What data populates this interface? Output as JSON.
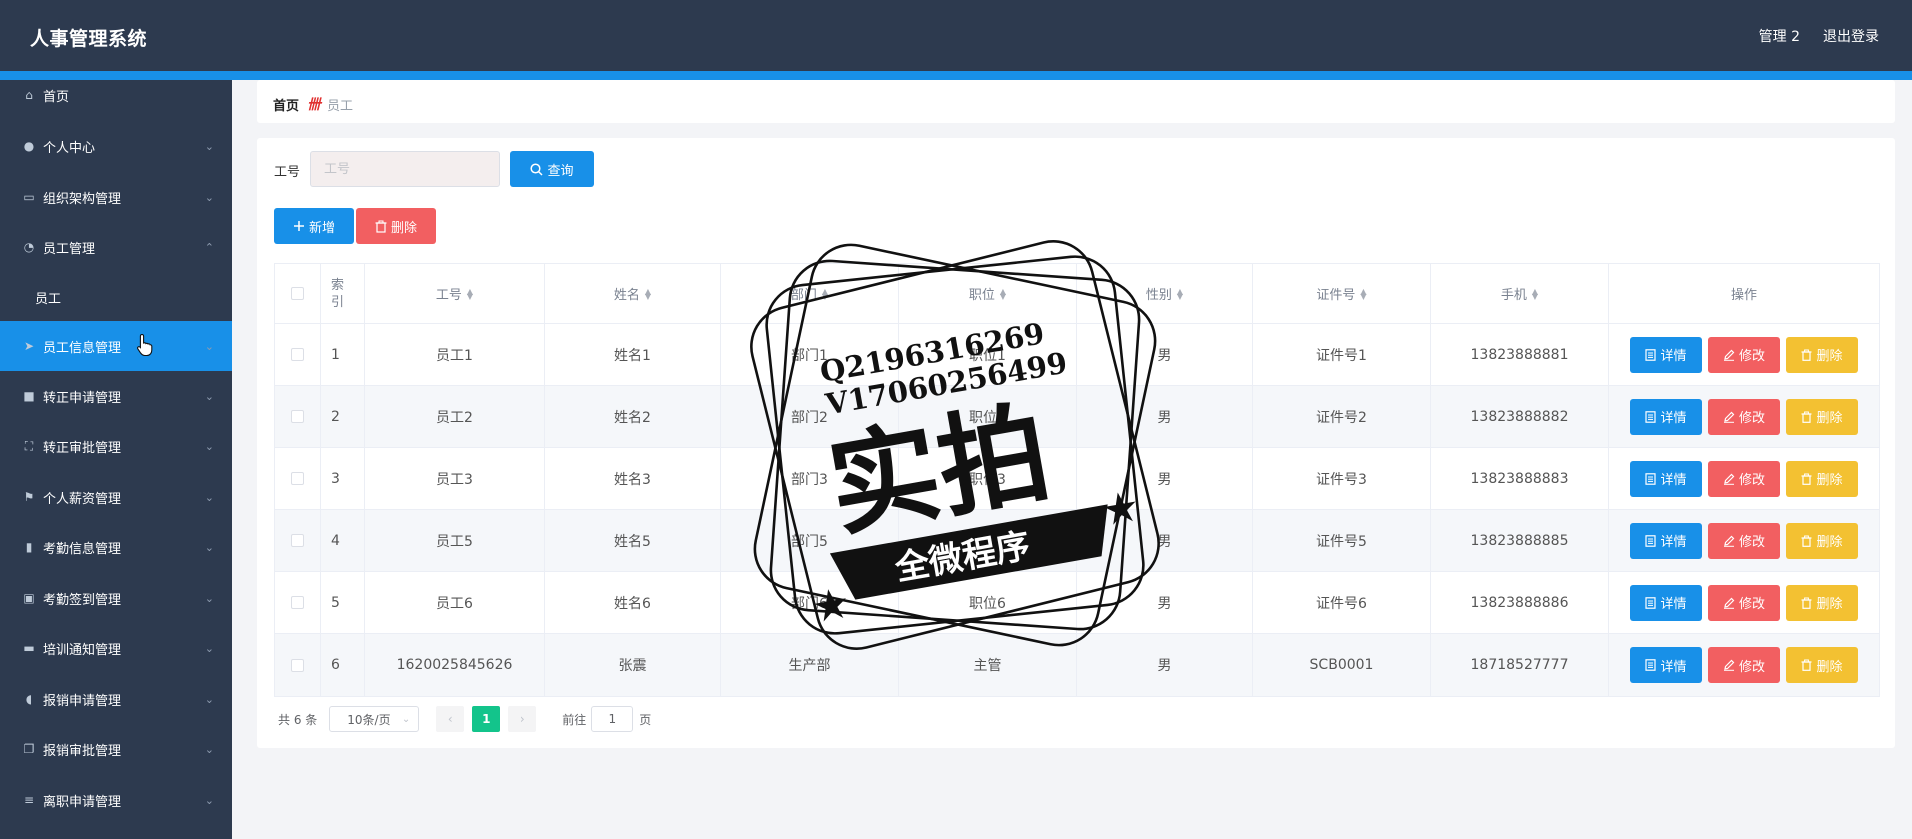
{
  "header": {
    "title": "人事管理系统",
    "user": "管理 2",
    "logout": "退出登录"
  },
  "sidebar": {
    "items": [
      {
        "label": "首页",
        "icon": "home-icon",
        "glyph": "⌂",
        "chevron": ""
      },
      {
        "label": "个人中心",
        "icon": "user-icon",
        "glyph": "●",
        "chevron": "⌄"
      },
      {
        "label": "组织架构管理",
        "icon": "message-icon",
        "glyph": "▭",
        "chevron": "⌄"
      },
      {
        "label": "员工管理",
        "icon": "compass-icon",
        "glyph": "◔",
        "chevron": "⌃"
      },
      {
        "label": "员工",
        "icon": "",
        "glyph": "",
        "chevron": ""
      },
      {
        "label": "员工信息管理",
        "icon": "send-icon",
        "glyph": "➤",
        "chevron": "⌄"
      },
      {
        "label": "转正申请管理",
        "icon": "chat-icon",
        "glyph": "■",
        "chevron": "⌄"
      },
      {
        "label": "转正审批管理",
        "icon": "fullscreen-icon",
        "glyph": "⛶",
        "chevron": "⌄"
      },
      {
        "label": "个人薪资管理",
        "icon": "flag-icon",
        "glyph": "⚑",
        "chevron": "⌄"
      },
      {
        "label": "考勤信息管理",
        "icon": "chart-icon",
        "glyph": "▮",
        "chevron": "⌄"
      },
      {
        "label": "考勤签到管理",
        "icon": "checklist-icon",
        "glyph": "▣",
        "chevron": "⌄"
      },
      {
        "label": "培训通知管理",
        "icon": "ticket-icon",
        "glyph": "▬",
        "chevron": "⌄"
      },
      {
        "label": "报销申请管理",
        "icon": "microphone-icon",
        "glyph": "◖",
        "chevron": "⌄"
      },
      {
        "label": "报销审批管理",
        "icon": "copy-icon",
        "glyph": "❐",
        "chevron": "⌄"
      },
      {
        "label": "离职申请管理",
        "icon": "list-icon",
        "glyph": "≡",
        "chevron": "⌄"
      }
    ]
  },
  "breadcrumb": {
    "home": "首页",
    "separator": "卌",
    "current": "员工"
  },
  "search": {
    "label": "工号",
    "placeholder": "工号",
    "query_label": "查询"
  },
  "toolbar": {
    "add_label": "新增",
    "delete_label": "删除"
  },
  "table": {
    "headers": {
      "index": "索引",
      "employee_no": "工号",
      "name": "姓名",
      "department": "部门",
      "position": "职位",
      "gender": "性别",
      "id_no": "证件号",
      "phone": "手机",
      "actions": "操作"
    },
    "rows": [
      {
        "index": "1",
        "employee_no": "员工1",
        "name": "姓名1",
        "department": "部门1",
        "position": "职位1",
        "gender": "男",
        "id_no": "证件号1",
        "phone": "13823888881"
      },
      {
        "index": "2",
        "employee_no": "员工2",
        "name": "姓名2",
        "department": "部门2",
        "position": "职位2",
        "gender": "男",
        "id_no": "证件号2",
        "phone": "13823888882"
      },
      {
        "index": "3",
        "employee_no": "员工3",
        "name": "姓名3",
        "department": "部门3",
        "position": "职位3",
        "gender": "男",
        "id_no": "证件号3",
        "phone": "13823888883"
      },
      {
        "index": "4",
        "employee_no": "员工5",
        "name": "姓名5",
        "department": "部门5",
        "position": "职位5",
        "gender": "男",
        "id_no": "证件号5",
        "phone": "13823888885"
      },
      {
        "index": "5",
        "employee_no": "员工6",
        "name": "姓名6",
        "department": "部门6",
        "position": "职位6",
        "gender": "男",
        "id_no": "证件号6",
        "phone": "13823888886"
      },
      {
        "index": "6",
        "employee_no": "1620025845626",
        "name": "张震",
        "department": "生产部",
        "position": "主管",
        "gender": "男",
        "id_no": "SCB0001",
        "phone": "18718527777"
      }
    ],
    "row_actions": {
      "detail": "详情",
      "edit": "修改",
      "delete": "删除"
    }
  },
  "pagination": {
    "total": "共 6 条",
    "page_size": "10条/页",
    "current_page": "1",
    "goto_label": "前往",
    "goto_value": "1",
    "page_suffix": "页"
  },
  "watermark": {
    "line1": "Q2196316269",
    "line2": "V17060256499",
    "main": "实拍",
    "banner": "全微程序"
  },
  "colors": {
    "header_bg": "#2d3a4f",
    "accent_blue": "#1890e8",
    "danger_red": "#f25f61",
    "warning_yellow": "#f3c132",
    "pager_active": "#13c48b"
  }
}
